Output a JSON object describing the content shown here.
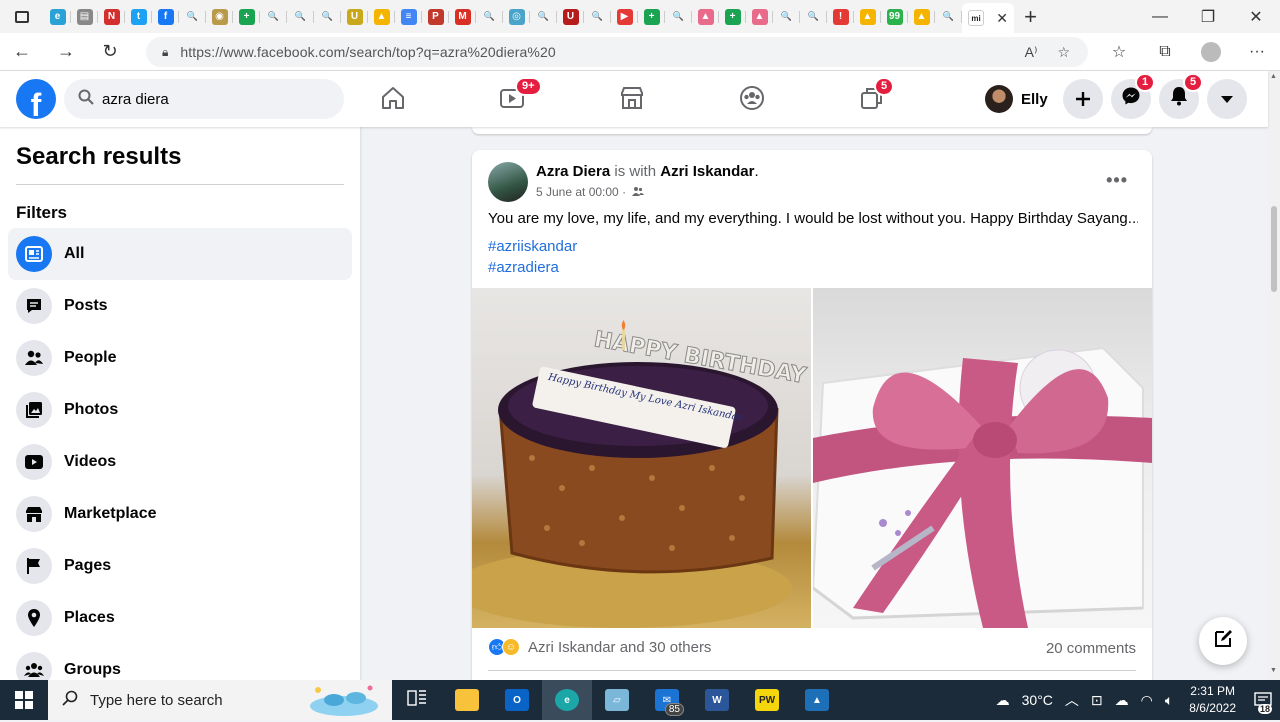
{
  "browser": {
    "url": "https://www.facebook.com/search/top?q=azra%20diera%20",
    "active_tab_favicon": "mi",
    "tabs": [
      {
        "icon": "edge-icon",
        "color": "#2aa2d6",
        "glyph": "e"
      },
      {
        "icon": "page-icon",
        "color": "#888888",
        "glyph": "▤"
      },
      {
        "icon": "netflix-icon",
        "color": "#d32f2f",
        "glyph": "N"
      },
      {
        "icon": "twitter-icon",
        "color": "#1da1f2",
        "glyph": "t"
      },
      {
        "icon": "facebook-icon",
        "color": "#1877f2",
        "glyph": "f"
      },
      {
        "icon": "search-icon",
        "color": "#5f6a78",
        "glyph": "🔍"
      },
      {
        "icon": "seal-icon",
        "color": "#b89a4a",
        "glyph": "◉"
      },
      {
        "icon": "plus-icon",
        "color": "#1aa351",
        "glyph": "+"
      },
      {
        "icon": "search-icon",
        "color": "#5f6a78",
        "glyph": "🔍"
      },
      {
        "icon": "search-icon",
        "color": "#5f6a78",
        "glyph": "🔍"
      },
      {
        "icon": "search-icon",
        "color": "#1f5fa8",
        "glyph": "🔍"
      },
      {
        "icon": "u-icon",
        "color": "#c9a81b",
        "glyph": "U"
      },
      {
        "icon": "drive-icon",
        "color": "#f4b400",
        "glyph": "▲"
      },
      {
        "icon": "docs-icon",
        "color": "#4285f4",
        "glyph": "≡"
      },
      {
        "icon": "pdf-icon",
        "color": "#c0392b",
        "glyph": "P"
      },
      {
        "icon": "gmail-icon",
        "color": "#d93025",
        "glyph": "M"
      },
      {
        "icon": "search-icon",
        "color": "#5f6a78",
        "glyph": "🔍"
      },
      {
        "icon": "scan-icon",
        "color": "#4aa3c8",
        "glyph": "◎"
      },
      {
        "icon": "search-icon",
        "color": "#5f6a78",
        "glyph": "🔍"
      },
      {
        "icon": "u-red-icon",
        "color": "#b71c1c",
        "glyph": "U"
      },
      {
        "icon": "search-icon",
        "color": "#1f5fa8",
        "glyph": "🔍"
      },
      {
        "icon": "youtube-icon",
        "color": "#e53935",
        "glyph": "▶"
      },
      {
        "icon": "plus-icon",
        "color": "#1aa351",
        "glyph": "+"
      },
      {
        "icon": "search-icon",
        "color": "#5f6a78",
        "glyph": "🔍"
      },
      {
        "icon": "photo-icon",
        "color": "#e86b8c",
        "glyph": "▲"
      },
      {
        "icon": "plus-icon",
        "color": "#1aa351",
        "glyph": "+"
      },
      {
        "icon": "photo-icon",
        "color": "#e86b8c",
        "glyph": "▲"
      },
      {
        "icon": "search-icon",
        "color": "#5f6a78",
        "glyph": "🔍"
      },
      {
        "icon": "search-icon",
        "color": "#1f5fa8",
        "glyph": "🔍"
      },
      {
        "icon": "alert-icon",
        "color": "#e53935",
        "glyph": "!"
      },
      {
        "icon": "drive-icon",
        "color": "#f4b400",
        "glyph": "▲"
      },
      {
        "icon": "99-icon",
        "color": "#2bb24c",
        "glyph": "99"
      },
      {
        "icon": "drive-icon",
        "color": "#f4b400",
        "glyph": "▲"
      },
      {
        "icon": "search-icon",
        "color": "#1f5fa8",
        "glyph": "🔍"
      }
    ]
  },
  "fb": {
    "logo": "f",
    "search_value": "azra diera",
    "watch_badge": "9+",
    "gaming_badge": "5",
    "user_name": "Elly",
    "messenger_badge": "1",
    "notif_badge": "5"
  },
  "sidebar": {
    "title": "Search results",
    "filters_label": "Filters",
    "items": [
      {
        "label": "All",
        "icon": "all-icon",
        "selected": true
      },
      {
        "label": "Posts",
        "icon": "posts-icon"
      },
      {
        "label": "People",
        "icon": "people-icon"
      },
      {
        "label": "Photos",
        "icon": "photos-icon"
      },
      {
        "label": "Videos",
        "icon": "videos-icon"
      },
      {
        "label": "Marketplace",
        "icon": "marketplace-icon"
      },
      {
        "label": "Pages",
        "icon": "pages-icon"
      },
      {
        "label": "Places",
        "icon": "places-icon"
      },
      {
        "label": "Groups",
        "icon": "groups-icon"
      }
    ]
  },
  "post": {
    "author": "Azra Diera",
    "with_text": "is with",
    "tagged": "Azri Iskandar",
    "period": ".",
    "timestamp": "5 June at 00:00 ·",
    "text": "You are my love, my life, and my everything. I would be lost without you. Happy Birthday Sayang...",
    "hashtags": [
      "#azriiskandar",
      "#azradiera"
    ],
    "cake_topper": "HAPPY BIRTHDAY",
    "cake_plaque": "Happy Birthday My Love Azri Iskandar",
    "reactions_text": "Azri Iskandar and 30 others",
    "comments_text": "20 comments"
  },
  "taskbar": {
    "search_placeholder": "Type here to search",
    "mail_badge": "85",
    "weather": "30°C",
    "time": "2:31 PM",
    "date": "8/6/2022",
    "notif_count": "18"
  }
}
